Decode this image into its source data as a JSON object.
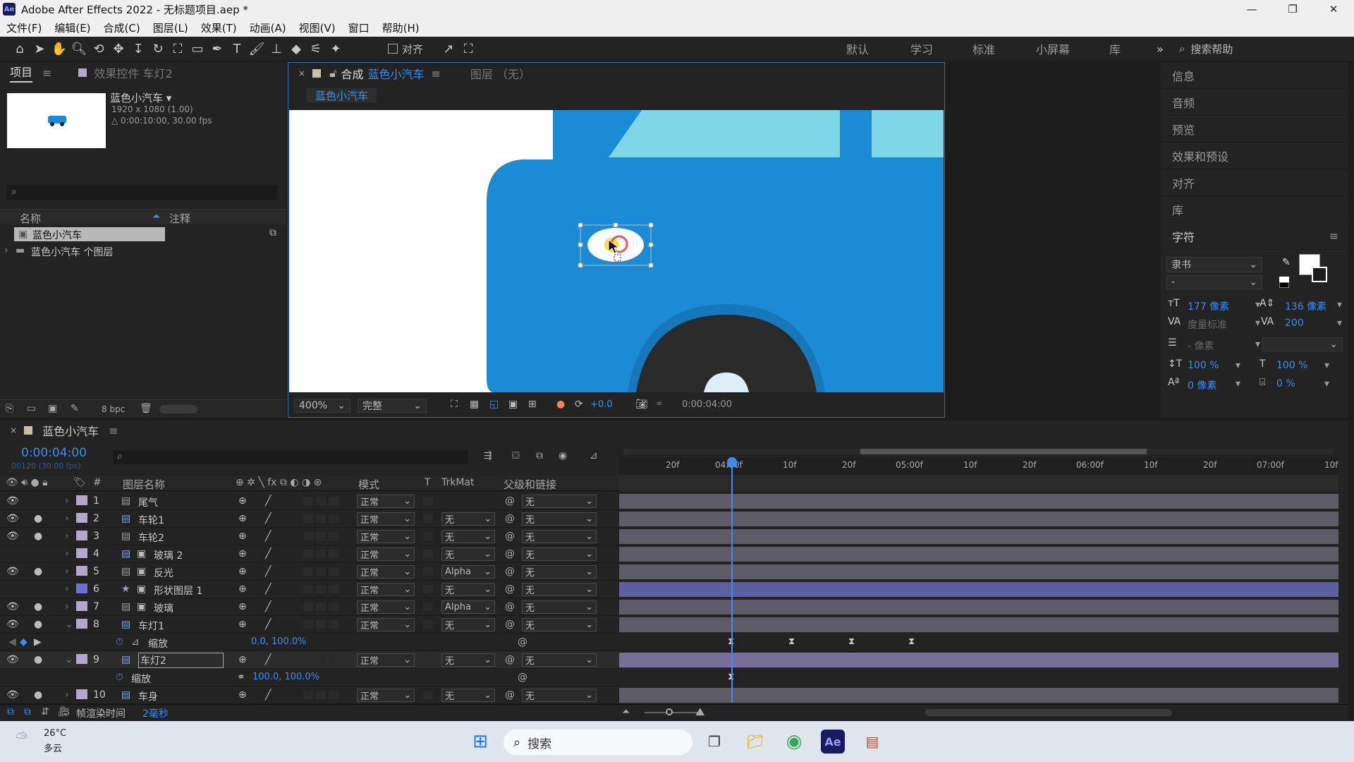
{
  "window": {
    "title": "Adobe After Effects 2022 - 无标题项目.aep *",
    "app_icon": "Ae"
  },
  "menu": [
    "文件(F)",
    "编辑(E)",
    "合成(C)",
    "图层(L)",
    "效果(T)",
    "动画(A)",
    "视图(V)",
    "窗口",
    "帮助(H)"
  ],
  "toolbar": {
    "align_label": "对齐",
    "workspaces": [
      "默认",
      "学习",
      "标准",
      "小屏幕",
      "库"
    ],
    "search_placeholder": "搜索帮助"
  },
  "project": {
    "tab": "项目",
    "tab2": "效果控件 车灯2",
    "comp_name": "蓝色小汽车 ▾",
    "comp_size": "1920 x 1080 (1.00)",
    "comp_duration": "△ 0:00:10:00, 30.00 fps",
    "col_name": "名称",
    "col_comment": "注释",
    "items": [
      "蓝色小汽车",
      "蓝色小汽车 个图层"
    ],
    "bpc": "8 bpc"
  },
  "comp": {
    "tab_prefix": "合成",
    "tab_name": "蓝色小汽车",
    "layer_tab": "图层 （无）",
    "flow_tab": "蓝色小汽车",
    "zoom": "400%",
    "quality": "完整",
    "exposure": "+0.0",
    "timecode": "0:00:04:00"
  },
  "right_panels": [
    "信息",
    "音频",
    "预览",
    "效果和预设",
    "对齐",
    "库"
  ],
  "character": {
    "title": "字符",
    "font": "隶书",
    "style": "-",
    "size": "177 像素",
    "leading": "136 像素",
    "kerning": "度量标准",
    "tracking": "200",
    "stroke": "- 像素",
    "vscale": "100 %",
    "hscale": "100 %",
    "baseline": "0 像素",
    "tsume": "0 %"
  },
  "timeline": {
    "comp_tab": "蓝色小汽车",
    "timecode": "0:00:04:00",
    "frames": "00120 (30.00 fps)",
    "headers": {
      "num": "#",
      "name": "图层名称",
      "mode": "模式",
      "t": "T",
      "trkmat": "TrkMat",
      "parent": "父级和链接"
    },
    "ruler": [
      "20f",
      "04:00f",
      "10f",
      "20f",
      "05:00f",
      "10f",
      "20f",
      "06:00f",
      "10f",
      "20f",
      "07:00f",
      "10f"
    ],
    "layers": [
      {
        "num": "1",
        "name": "尾气",
        "mode": "正常",
        "trkmat": "",
        "parent": "无"
      },
      {
        "num": "2",
        "name": "车轮1",
        "mode": "正常",
        "trkmat": "无",
        "parent": "无"
      },
      {
        "num": "3",
        "name": "车轮2",
        "mode": "正常",
        "trkmat": "无",
        "parent": "无"
      },
      {
        "num": "4",
        "name": "玻璃 2",
        "mode": "正常",
        "trkmat": "无",
        "parent": "无"
      },
      {
        "num": "5",
        "name": "反光",
        "mode": "正常",
        "trkmat": "Alpha",
        "parent": "无"
      },
      {
        "num": "6",
        "name": "形状图层 1",
        "mode": "正常",
        "trkmat": "无",
        "parent": "无"
      },
      {
        "num": "7",
        "name": "玻璃",
        "mode": "正常",
        "trkmat": "Alpha",
        "parent": "无"
      },
      {
        "num": "8",
        "name": "车灯1",
        "mode": "正常",
        "trkmat": "无",
        "parent": "无"
      },
      {
        "num": "9",
        "name": "车灯2",
        "mode": "正常",
        "trkmat": "无",
        "parent": "无"
      },
      {
        "num": "10",
        "name": "车身",
        "mode": "正常",
        "trkmat": "无",
        "parent": "无"
      }
    ],
    "prop8": {
      "name": "缩放",
      "value": "0.0, 100.0%"
    },
    "prop9": {
      "name": "缩放",
      "value": "100.0, 100.0%"
    },
    "status": "帧渲染时间",
    "status_value": "2毫秒"
  },
  "taskbar": {
    "temp": "26°C",
    "weather": "多云",
    "search": "搜索"
  }
}
